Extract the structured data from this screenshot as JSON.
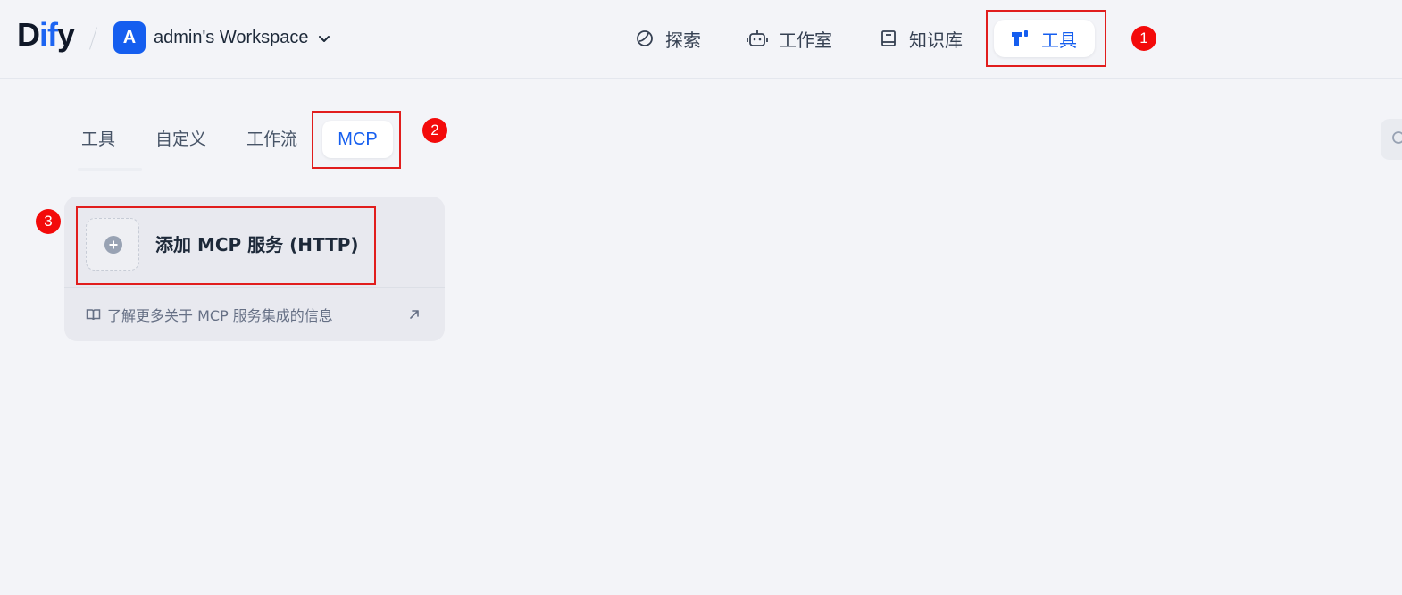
{
  "header": {
    "logo": {
      "part1": "D",
      "part2": "if",
      "part3": "y"
    },
    "workspace": {
      "avatar_letter": "A",
      "name": "admin's Workspace"
    },
    "nav": [
      {
        "label": "探索",
        "icon": "compass-icon"
      },
      {
        "label": "工作室",
        "icon": "robot-icon"
      },
      {
        "label": "知识库",
        "icon": "book-icon"
      },
      {
        "label": "工具",
        "icon": "tools-icon",
        "active": true
      }
    ]
  },
  "tabs": [
    {
      "label": "工具"
    },
    {
      "label": "自定义"
    },
    {
      "label": "工作流"
    },
    {
      "label": "MCP",
      "active": true
    }
  ],
  "card": {
    "add_label": "添加 MCP 服务 (HTTP)",
    "learn_more": "了解更多关于 MCP 服务集成的信息"
  },
  "annotations": [
    "1",
    "2",
    "3"
  ],
  "colors": {
    "accent": "#155eef",
    "annotation": "#e11d1d",
    "background": "#f3f4f8"
  }
}
